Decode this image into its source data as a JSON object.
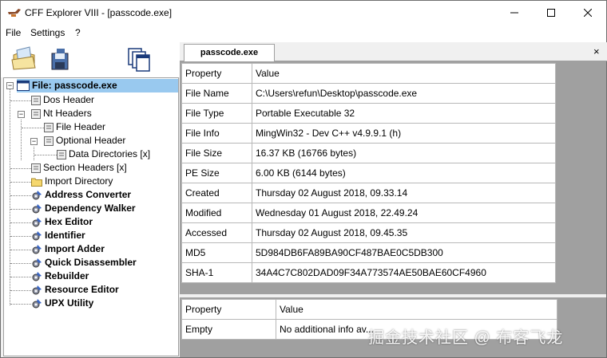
{
  "window": {
    "title": "CFF Explorer VIII - [passcode.exe]"
  },
  "menu": {
    "file": "File",
    "settings": "Settings",
    "help": "?"
  },
  "tree": {
    "root": "File: passcode.exe",
    "dos_header": "Dos Header",
    "nt_headers": "Nt Headers",
    "file_header": "File Header",
    "optional_header": "Optional Header",
    "data_directories": "Data Directories [x]",
    "section_headers": "Section Headers [x]",
    "import_directory": "Import Directory",
    "tools": [
      "Address Converter",
      "Dependency Walker",
      "Hex Editor",
      "Identifier",
      "Import Adder",
      "Quick Disassembler",
      "Rebuilder",
      "Resource Editor",
      "UPX Utility"
    ]
  },
  "tab": {
    "label": "passcode.exe",
    "close": "×"
  },
  "main_table": {
    "headers": [
      "Property",
      "Value"
    ],
    "rows": [
      [
        "File Name",
        "C:\\Users\\refun\\Desktop\\passcode.exe"
      ],
      [
        "File Type",
        "Portable Executable 32"
      ],
      [
        "File Info",
        "MingWin32 - Dev C++ v4.9.9.1 (h)"
      ],
      [
        "File Size",
        "16.37 KB (16766 bytes)"
      ],
      [
        "PE Size",
        "6.00 KB (6144 bytes)"
      ],
      [
        "Created",
        "Thursday 02 August 2018, 09.33.14"
      ],
      [
        "Modified",
        "Wednesday 01 August 2018, 22.49.24"
      ],
      [
        "Accessed",
        "Thursday 02 August 2018, 09.45.35"
      ],
      [
        "MD5",
        "5D984DB6FA89BA90CF487BAE0C5DB300"
      ],
      [
        "SHA-1",
        "34A4C7C802DAD09F34A773574AE50BAE60CF4960"
      ]
    ]
  },
  "info_table": {
    "headers": [
      "Property",
      "Value"
    ],
    "rows": [
      [
        "Empty",
        "No additional info av..."
      ]
    ]
  },
  "watermark": "掘金技术社区 @ 布客飞龙"
}
